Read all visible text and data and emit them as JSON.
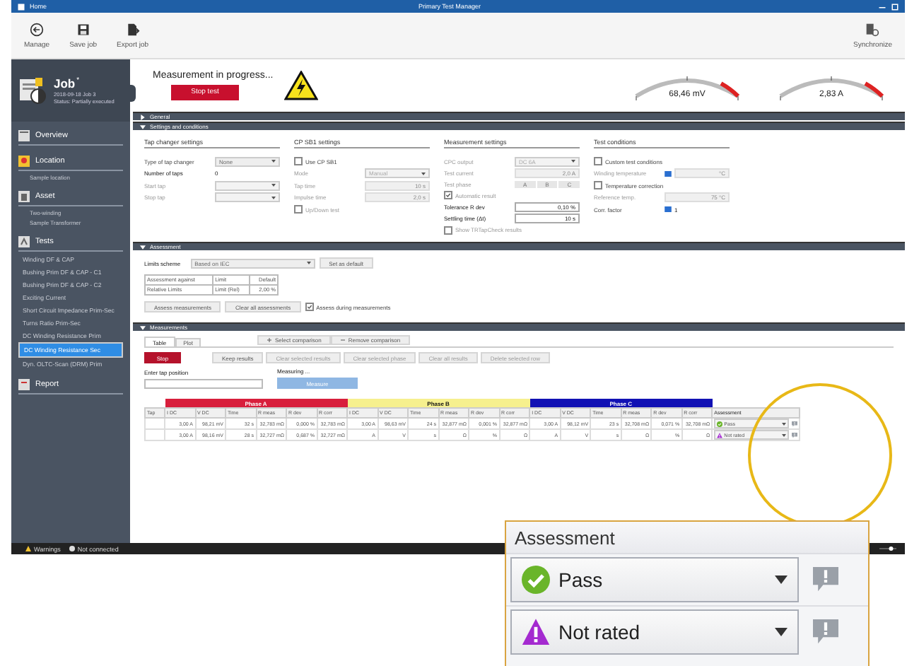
{
  "window": {
    "title": "Home",
    "app_title": "Primary Test Manager"
  },
  "toolbar": [
    {
      "label": "Manage",
      "kind": "manage"
    },
    {
      "label": "Save job",
      "kind": "save"
    },
    {
      "label": "Export job",
      "kind": "export"
    }
  ],
  "toolbar_right": {
    "label": "Synchronize",
    "kind": "sync"
  },
  "job": {
    "title": "Job",
    "modified_mark": "*",
    "date": "2018-09-18 Job 3",
    "status": "Status: Partially executed"
  },
  "sidebar": [
    {
      "kind": "overview",
      "title": "Overview"
    },
    {
      "kind": "location",
      "title": "Location",
      "items": [
        {
          "label": "Sample location",
          "selected": false
        }
      ]
    },
    {
      "kind": "asset",
      "title": "Asset",
      "items": [
        {
          "label": "Two-winding",
          "selected": false
        },
        {
          "label": "Sample Transformer",
          "selected": false
        }
      ]
    },
    {
      "kind": "tests",
      "title": "Tests",
      "items": [
        {
          "label": "Winding DF & CAP",
          "selected": false
        },
        {
          "label": "Bushing Prim DF & CAP - C1",
          "selected": false
        },
        {
          "label": "Bushing Prim DF & CAP - C2",
          "selected": false
        },
        {
          "label": "Exciting Current",
          "selected": false
        },
        {
          "label": "Short Circuit Impedance Prim-Sec",
          "selected": false
        },
        {
          "label": "Turns Ratio Prim-Sec",
          "selected": false
        },
        {
          "label": "DC Winding Resistance Prim",
          "selected": false
        },
        {
          "label": "DC Winding Resistance Sec",
          "selected": true
        },
        {
          "label": "Dyn. OLTC-Scan (DRM) Prim",
          "selected": false
        }
      ]
    },
    {
      "kind": "report",
      "title": "Report"
    }
  ],
  "progress": {
    "message": "Measurement in progress...",
    "stop_button": "Stop test"
  },
  "gauges": [
    {
      "reading": "68,46 mV"
    },
    {
      "reading": "2,83 A"
    }
  ],
  "general": {
    "title": "General",
    "expanded": false
  },
  "settings": {
    "title": "Settings and conditions",
    "expanded": true,
    "groups": [
      {
        "title": "Tap changer settings",
        "items": [
          {
            "kind": "select",
            "label": "Type of tap changer",
            "value": "None",
            "disabled": false
          },
          {
            "kind": "value",
            "label": "Number of taps",
            "value": "0",
            "disabled": false
          },
          {
            "kind": "select",
            "label": "Start tap",
            "disabled": true
          },
          {
            "kind": "select",
            "label": "Stop tap",
            "disabled": true
          }
        ]
      },
      {
        "title": "CP SB1 settings",
        "items": [
          {
            "kind": "checkbox",
            "label": "Use CP SB1",
            "checked": false,
            "disabled": false
          },
          {
            "kind": "select",
            "label": "Mode",
            "value": "Manual",
            "disabled": true
          },
          {
            "kind": "field",
            "label": "Tap time",
            "value": "10 s",
            "disabled": true
          },
          {
            "kind": "field",
            "label": "Impulse time",
            "value": "2,0 s",
            "disabled": true
          },
          {
            "kind": "checkbox",
            "label": "Up/Down test",
            "checked": false,
            "disabled": true
          }
        ]
      },
      {
        "title": "Measurement settings",
        "items": [
          {
            "kind": "select",
            "label": "CPC output",
            "value": "DC 6A",
            "disabled": true
          },
          {
            "kind": "field",
            "label": "Test current",
            "value": "2,0 A",
            "disabled": true
          },
          {
            "kind": "segmented",
            "label": "Test phase",
            "values": [
              "A",
              "B",
              "C"
            ],
            "disabled": true
          },
          {
            "kind": "checkbox",
            "label": "Automatic result",
            "checked": true,
            "disabled": true
          },
          {
            "kind": "field",
            "label": "Tolerance R dev",
            "value": "0,10 %",
            "disabled": false
          },
          {
            "kind": "field",
            "label": "Settling time (Δt)",
            "value": "10 s",
            "disabled": false
          },
          {
            "kind": "checkbox",
            "label": "Show TRTapCheck results",
            "checked": false,
            "disabled": true
          }
        ]
      },
      {
        "title": "Test conditions",
        "items": [
          {
            "kind": "checkbox",
            "label": "Custom test conditions",
            "checked": false,
            "disabled": false
          },
          {
            "kind": "info_field",
            "label": "Winding temperature",
            "value": "°C",
            "disabled": true
          },
          {
            "kind": "checkbox",
            "label": "Temperature correction",
            "checked": false,
            "disabled": false
          },
          {
            "kind": "field",
            "label": "Reference temp.",
            "value": "75 °C",
            "disabled": true
          },
          {
            "kind": "info_value",
            "label": "Corr. factor",
            "value": "1",
            "disabled": false
          }
        ]
      }
    ]
  },
  "assessment": {
    "title": "Assessment",
    "expanded": true,
    "limits_label": "Limits scheme",
    "limits_value": "Based on IEC",
    "default_button": "Set as default",
    "columns": [
      "Assessment against",
      "Limit",
      "Default"
    ],
    "rows": [
      [
        "Relative Limits",
        "Limit (Rel)",
        "2,00 %"
      ]
    ],
    "buttons": [
      "Assess measurements",
      "Clear all assessments"
    ],
    "assess_during": {
      "label": "Assess during measurements",
      "checked": true
    }
  },
  "measurements": {
    "title": "Measurements",
    "expanded": true,
    "tabs": [
      {
        "label": "Table",
        "selected": true
      },
      {
        "label": "Plot",
        "selected": false
      }
    ],
    "comparison_buttons": [
      {
        "label": "Select comparison",
        "kind": "add"
      },
      {
        "label": "Remove comparison",
        "kind": "remove"
      }
    ],
    "stop_button": "Stop",
    "result_buttons": [
      {
        "label": "Keep results",
        "disabled": false
      },
      {
        "label": "Clear selected results",
        "disabled": true
      },
      {
        "label": "Clear selected phase",
        "disabled": true
      },
      {
        "label": "Clear all results",
        "disabled": true
      },
      {
        "label": "Delete selected row",
        "disabled": true
      }
    ],
    "tap_position": {
      "label": "Enter tap position"
    },
    "measuring": {
      "label": "Measuring ...",
      "button": "Measure",
      "disabled": true
    },
    "table": {
      "tap_header": "Tap",
      "assessment_header": "Assessment",
      "phases": [
        {
          "name": "Phase A",
          "color": "#d81f3c",
          "columns": [
            "I DC",
            "V DC",
            "Time",
            "R meas",
            "R dev",
            "R corr"
          ]
        },
        {
          "name": "Phase B",
          "color": "#f6f08e",
          "columns": [
            "I DC",
            "V DC",
            "Time",
            "R meas",
            "R dev",
            "R corr"
          ]
        },
        {
          "name": "Phase C",
          "color": "#1111b4",
          "columns": [
            "I DC",
            "V DC",
            "Time",
            "R meas",
            "R dev",
            "R corr"
          ]
        }
      ],
      "rows": [
        {
          "phases": [
            [
              "3,00 A",
              "98,21 mV",
              "32 s",
              "32,783 mΩ",
              "0,000 %",
              "32,783 mΩ"
            ],
            [
              "3,00 A",
              "98,63 mV",
              "24 s",
              "32,877 mΩ",
              "0,001 %",
              "32,877 mΩ"
            ],
            [
              "3,00 A",
              "98,12 mV",
              "23 s",
              "32,708 mΩ",
              "0,071 %",
              "32,708 mΩ"
            ]
          ],
          "assessment": {
            "label": "Pass",
            "kind": "pass"
          }
        },
        {
          "phases": [
            [
              "3,00 A",
              "98,16 mV",
              "28 s",
              "32,727 mΩ",
              "0,687 %",
              "32,727 mΩ"
            ],
            [
              "A",
              "V",
              "s",
              "Ω",
              "%",
              "Ω"
            ],
            [
              "A",
              "V",
              "s",
              "Ω",
              "%",
              "Ω"
            ]
          ],
          "assessment": {
            "label": "Not rated",
            "kind": "not_rated"
          }
        }
      ]
    }
  },
  "status_bar": [
    {
      "label": "Warnings",
      "kind": "warning"
    },
    {
      "label": "Not connected",
      "kind": "disconnected"
    }
  ],
  "zoom_slider": {
    "level": 0.75
  },
  "callout": {
    "title": "Assessment",
    "rows": [
      {
        "label": "Pass",
        "kind": "pass"
      },
      {
        "label": "Not rated",
        "kind": "not_rated"
      }
    ]
  }
}
